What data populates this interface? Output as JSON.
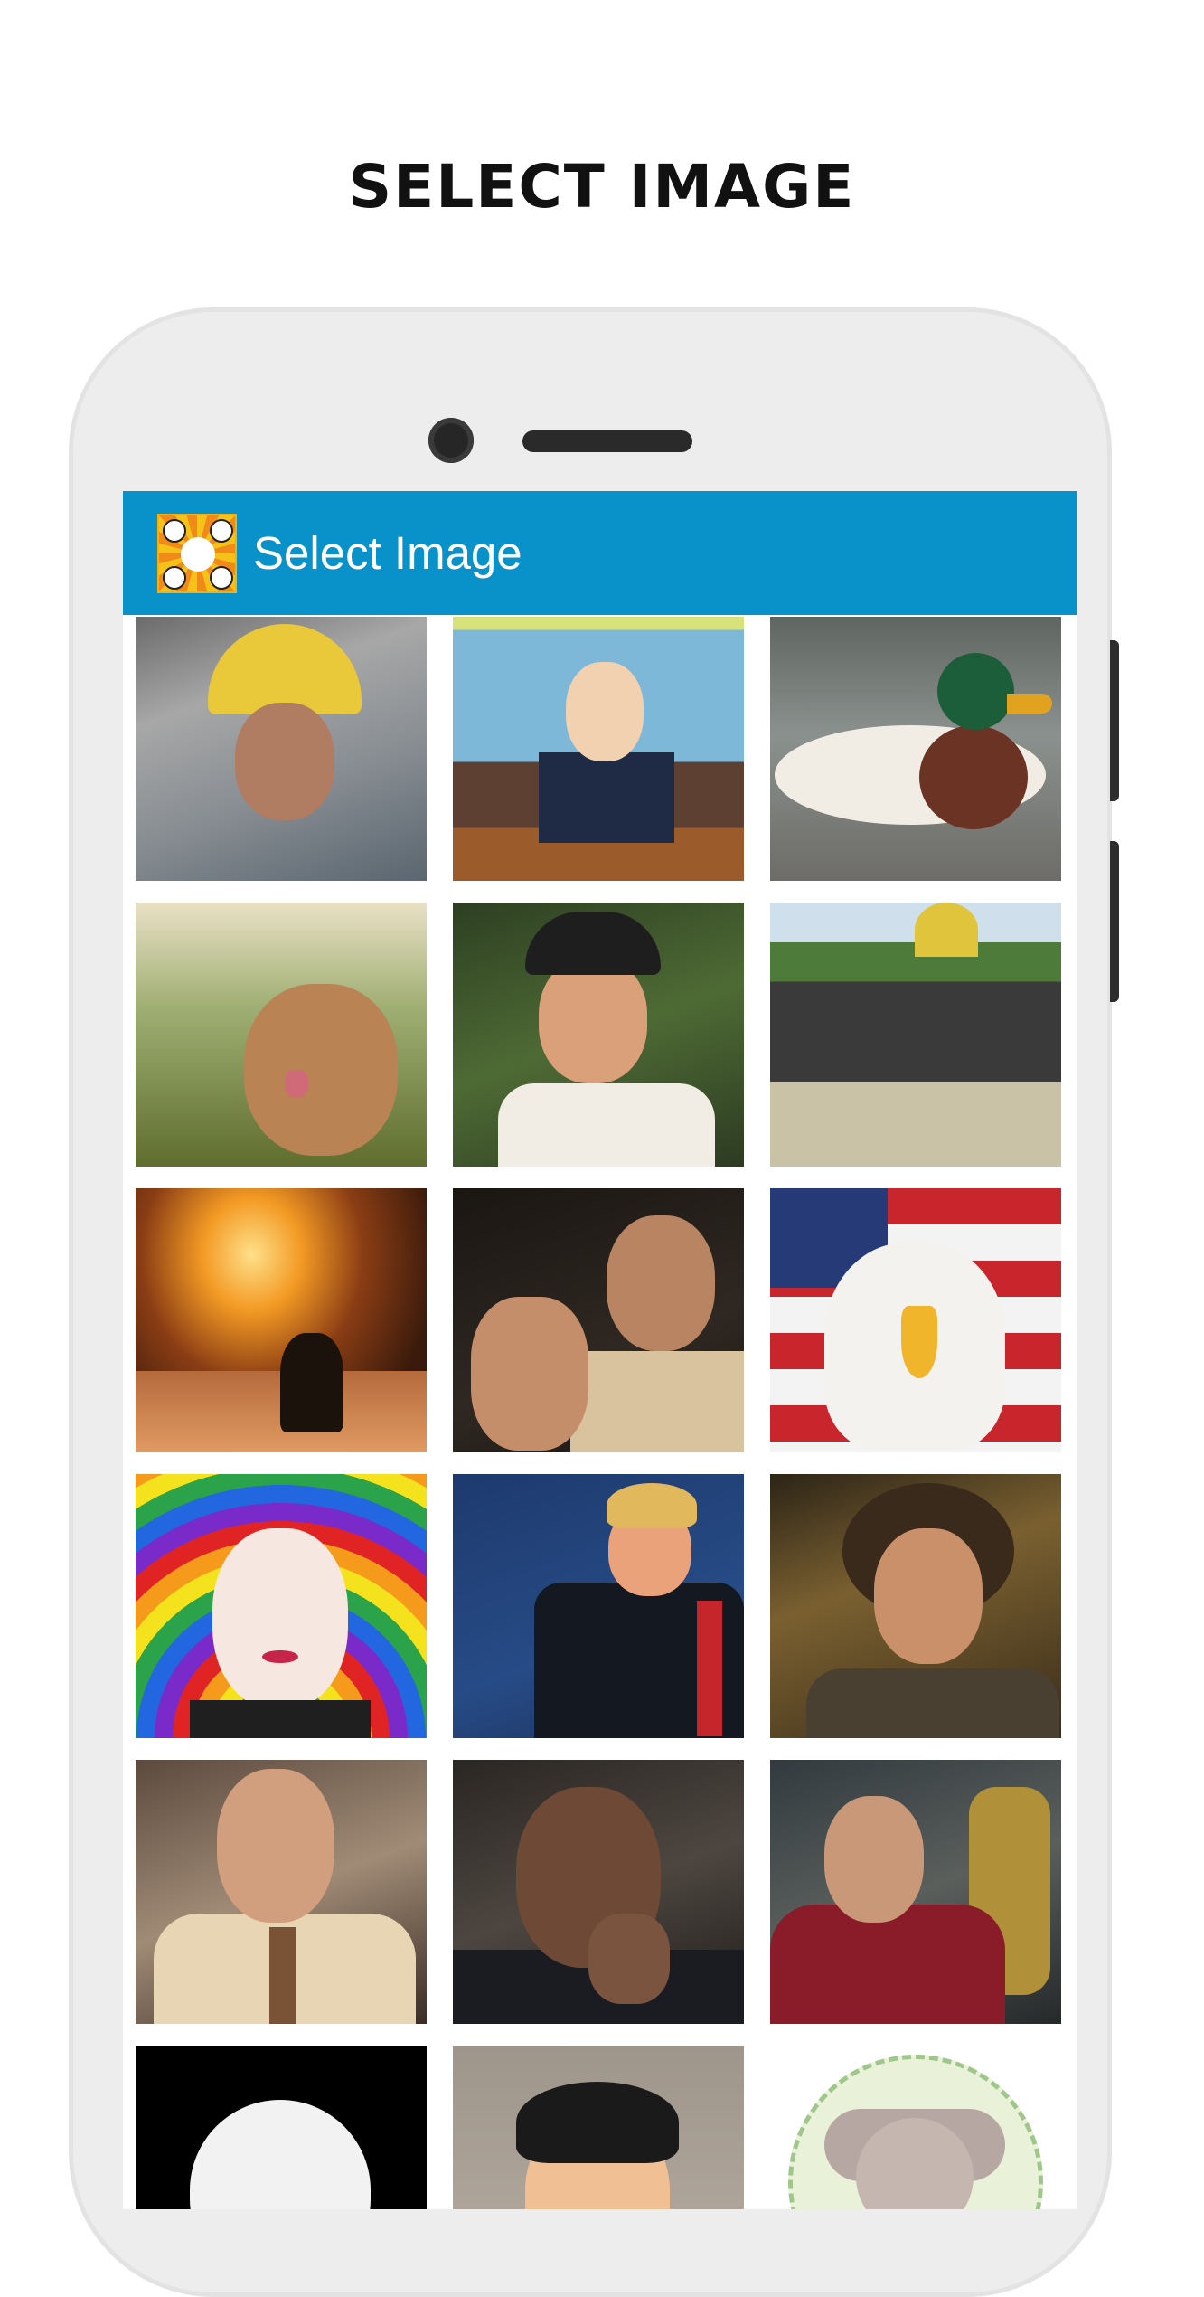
{
  "page": {
    "heading": "SELECT IMAGE"
  },
  "toolbar": {
    "title": "Select Image"
  },
  "thumbnails": [
    {
      "name": "thumb-dirty-jobs",
      "style": "t-dirty"
    },
    {
      "name": "thumb-south-park-anchor",
      "style": "t-office"
    },
    {
      "name": "thumb-mallard-duck",
      "style": "t-duck"
    },
    {
      "name": "thumb-photobomb-cat",
      "style": "t-cat"
    },
    {
      "name": "thumb-golfer",
      "style": "t-golf"
    },
    {
      "name": "thumb-crowd-cat",
      "style": "t-crowd"
    },
    {
      "name": "thumb-burning-house",
      "style": "t-fire"
    },
    {
      "name": "thumb-man-with-gun",
      "style": "t-gun"
    },
    {
      "name": "thumb-american-eagle",
      "style": "t-eagle"
    },
    {
      "name": "thumb-rainbow-portrait",
      "style": "t-putin"
    },
    {
      "name": "thumb-politician-speech",
      "style": "t-trump"
    },
    {
      "name": "thumb-aliens-guy",
      "style": "t-aliens"
    },
    {
      "name": "thumb-office-man",
      "style": "t-pratt"
    },
    {
      "name": "thumb-pointing-man",
      "style": "t-obama"
    },
    {
      "name": "thumb-captain-facepalm",
      "style": "t-picard"
    },
    {
      "name": "thumb-anonymous-mask",
      "style": "t-anon"
    },
    {
      "name": "thumb-cartoon-spy",
      "style": "t-archer"
    },
    {
      "name": "thumb-koala",
      "style": "t-koala"
    }
  ]
}
